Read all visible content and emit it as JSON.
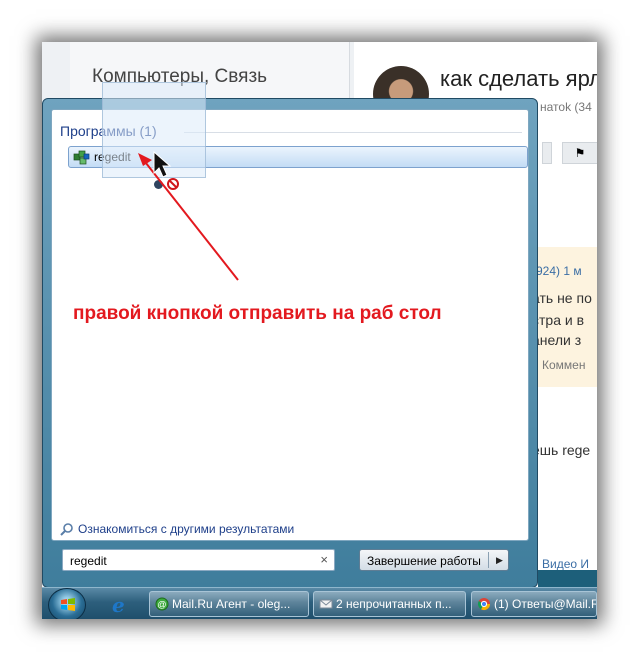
{
  "background_page": {
    "category": "Компьютеры, Связь",
    "question_title": "как сделать ярл",
    "user_stat": "натоk (34",
    "answer_meta": "(924) 1 м",
    "answer_lines": [
      "ать не по",
      "стра и в",
      "анели з"
    ],
    "comments": "Коммен",
    "answer2": "ешь rege",
    "video_link": "Видео  И"
  },
  "start_menu": {
    "programs_header": "Программы (1)",
    "result_label": "regedit",
    "see_more": "Ознакомиться с другими результатами",
    "search_value": "regedit",
    "clear_icon": "×",
    "shutdown_label": "Завершение работы",
    "shutdown_arrow": "▶"
  },
  "annotation": {
    "text": "правой кнопкой отправить на раб стол",
    "color": "#e3191f"
  },
  "taskbar": {
    "items": [
      {
        "label": "Mail.Ru Агент - oleg...",
        "icon": "mailru-agent-icon"
      },
      {
        "label": "2 непрочитанных п...",
        "icon": "envelope-icon"
      },
      {
        "label": "(1) Ответы@Mail.R",
        "icon": "chrome-icon"
      }
    ],
    "ie_glyph": "e"
  }
}
